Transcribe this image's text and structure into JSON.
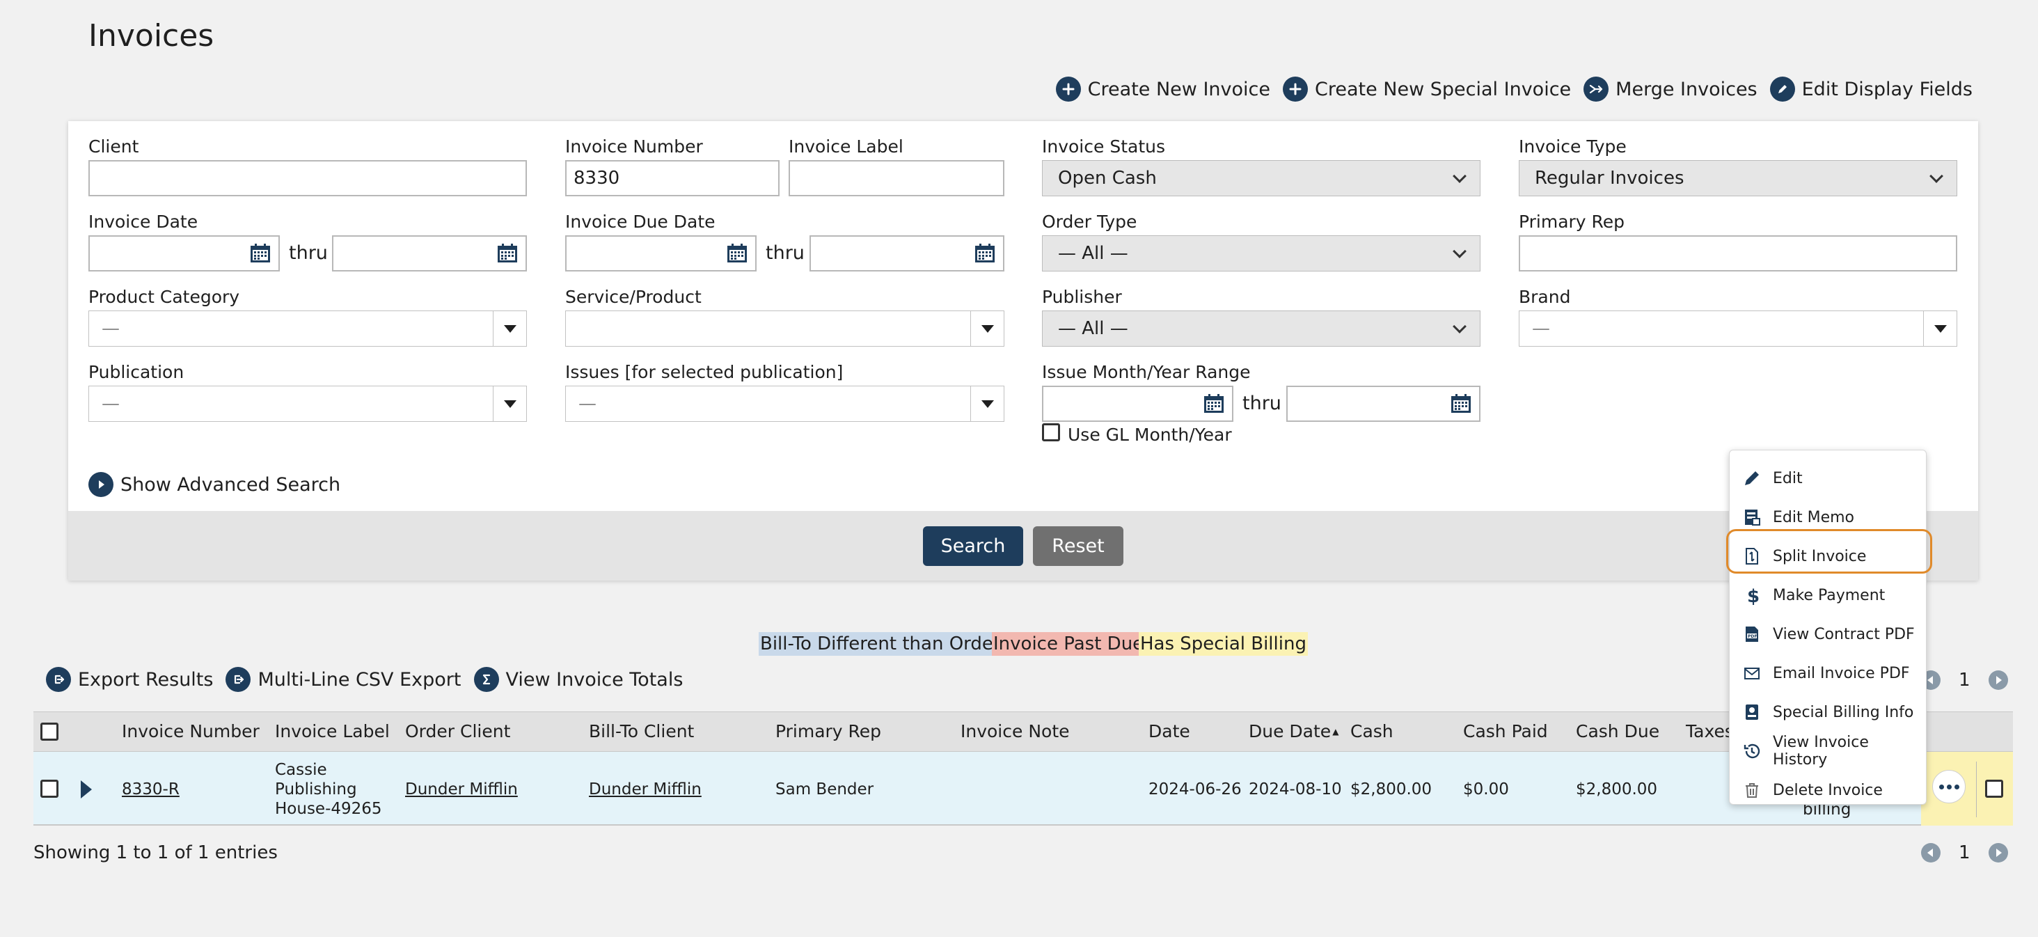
{
  "page": {
    "title": "Invoices"
  },
  "top_actions": [
    {
      "label": "Create New Invoice",
      "icon": "plus-icon"
    },
    {
      "label": "Create New Special Invoice",
      "icon": "plus-icon"
    },
    {
      "label": "Merge Invoices",
      "icon": "merge-icon"
    },
    {
      "label": "Edit Display Fields",
      "icon": "pencil-icon"
    }
  ],
  "filters": {
    "client": {
      "label": "Client",
      "value": ""
    },
    "invoice_number": {
      "label": "Invoice Number",
      "value": "8330"
    },
    "invoice_label": {
      "label": "Invoice Label",
      "value": ""
    },
    "invoice_status": {
      "label": "Invoice Status",
      "value": "Open Cash"
    },
    "invoice_type": {
      "label": "Invoice Type",
      "value": "Regular Invoices"
    },
    "invoice_date": {
      "label": "Invoice Date",
      "thru": "thru"
    },
    "invoice_due_date": {
      "label": "Invoice Due Date",
      "thru": "thru"
    },
    "order_type": {
      "label": "Order Type",
      "value": "— All —"
    },
    "primary_rep": {
      "label": "Primary Rep",
      "value": ""
    },
    "product_category": {
      "label": "Product Category",
      "value": "—"
    },
    "service_product": {
      "label": "Service/Product",
      "value": ""
    },
    "publisher": {
      "label": "Publisher",
      "value": "— All —"
    },
    "brand": {
      "label": "Brand",
      "value": "—"
    },
    "publication": {
      "label": "Publication",
      "value": "—"
    },
    "issues": {
      "label": "Issues [for selected publication]",
      "value": "—"
    },
    "issue_range": {
      "label": "Issue Month/Year Range",
      "thru": "thru"
    },
    "use_gl": {
      "label": "Use GL Month/Year"
    },
    "advanced": {
      "label": "Show Advanced Search"
    },
    "search_button": "Search",
    "reset_button": "Reset"
  },
  "legend": {
    "bill_to": "Bill-To Different than Order",
    "past_due": "Invoice Past Due",
    "special": "Has Special Billing"
  },
  "colors": {
    "bill_to": "#c9d9ea",
    "past_due": "#f2b8b0",
    "special": "#fbf2b3",
    "accent": "#1e3d5c",
    "highlight": "#e08a2a"
  },
  "result_actions": [
    {
      "label": "Export Results",
      "icon": "export-icon"
    },
    {
      "label": "Multi-Line CSV Export",
      "icon": "export-icon"
    },
    {
      "label": "View Invoice Totals",
      "icon": "sigma-icon"
    }
  ],
  "table": {
    "columns": [
      "Invoice Number",
      "Invoice Label",
      "Order Client",
      "Bill-To Client",
      "Primary Rep",
      "Invoice Note",
      "Date",
      "Due Date",
      "Cash",
      "Cash Paid",
      "Cash Due",
      "Taxes"
    ],
    "sort_indicator": "▲",
    "rows": [
      {
        "invoice_number": "8330-R",
        "invoice_label": [
          "Cassie",
          "Publishing",
          "House-49265"
        ],
        "order_client": "Dunder Mifflin",
        "bill_to_client": "Dunder Mifflin",
        "primary_rep": "Sam Bender",
        "invoice_note": "",
        "date": "2024-06-26",
        "due_date": "2024-08-10",
        "cash": "$2,800.00",
        "cash_paid": "$0.00",
        "cash_due": "$2,800.00",
        "partial_status": "billing"
      }
    ],
    "footer": "Showing 1 to 1 of 1 entries",
    "page": "1"
  },
  "context_menu": {
    "items": [
      {
        "label": "Edit",
        "icon": "pencil-icon"
      },
      {
        "label": "Edit Memo",
        "icon": "memo-icon"
      },
      {
        "label": "Split Invoice",
        "icon": "split-document-icon"
      },
      {
        "label": "Make Payment",
        "icon": "dollar-icon"
      },
      {
        "label": "View Contract PDF",
        "icon": "pdf-icon"
      },
      {
        "label": "Email Invoice PDF",
        "icon": "email-icon"
      },
      {
        "label": "Special Billing Info",
        "icon": "special-billing-icon"
      },
      {
        "label": "View Invoice History",
        "icon": "history-icon"
      },
      {
        "label": "Delete Invoice",
        "icon": "trash-icon"
      }
    ],
    "highlighted": "Split Invoice"
  }
}
